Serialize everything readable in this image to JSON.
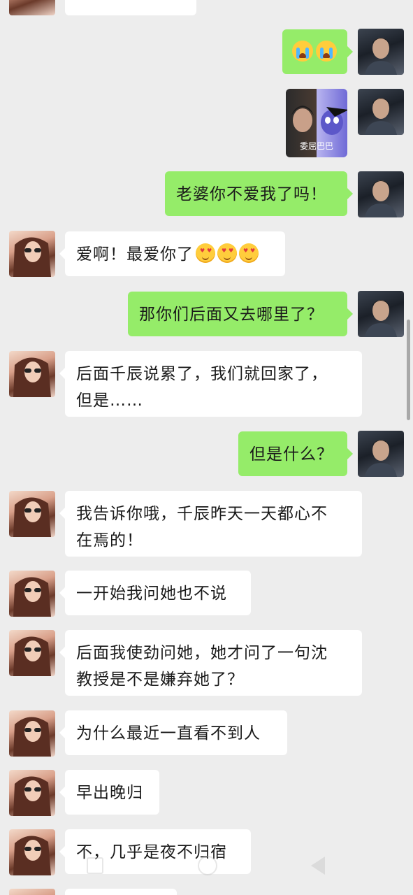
{
  "messages": [
    {
      "side": "right",
      "kind": "emoji",
      "emoji": [
        "loudly-crying-face-icon",
        "loudly-crying-face-icon"
      ]
    },
    {
      "side": "right",
      "kind": "sticker",
      "caption": "委屈巴巴"
    },
    {
      "side": "right",
      "kind": "text",
      "text": "老婆你不爱我了吗！"
    },
    {
      "side": "left",
      "kind": "text",
      "text": "爱啊！最爱你了"
    },
    {
      "side": "right",
      "kind": "text",
      "text": "那你们后面又去哪里了？"
    },
    {
      "side": "left",
      "kind": "text",
      "line1": "后面千辰说累了，我们就回家了，",
      "line2": "但是……"
    },
    {
      "side": "right",
      "kind": "text",
      "text": "但是什么？"
    },
    {
      "side": "left",
      "kind": "text",
      "line1": "我告诉你哦，千辰昨天一天都心不",
      "line2": "在焉的！"
    },
    {
      "side": "left",
      "kind": "text",
      "text": "一开始我问她也不说"
    },
    {
      "side": "left",
      "kind": "text",
      "line1": "后面我使劲问她，她才问了一句沈",
      "line2": "教授是不是嫌弃她了？"
    },
    {
      "side": "left",
      "kind": "text",
      "text": "为什么最近一直看不到人"
    },
    {
      "side": "left",
      "kind": "text",
      "text": "早出晚归"
    },
    {
      "side": "left",
      "kind": "text",
      "text": "不，几乎是夜不归宿"
    }
  ],
  "colors": {
    "background": "#ededed",
    "sent_bubble": "#95ec69",
    "received_bubble": "#ffffff"
  },
  "icons": {
    "heart_eyes": "smiling-face-with-heart-eyes-icon",
    "nav": [
      "recent-apps-icon",
      "home-icon",
      "back-icon"
    ]
  }
}
